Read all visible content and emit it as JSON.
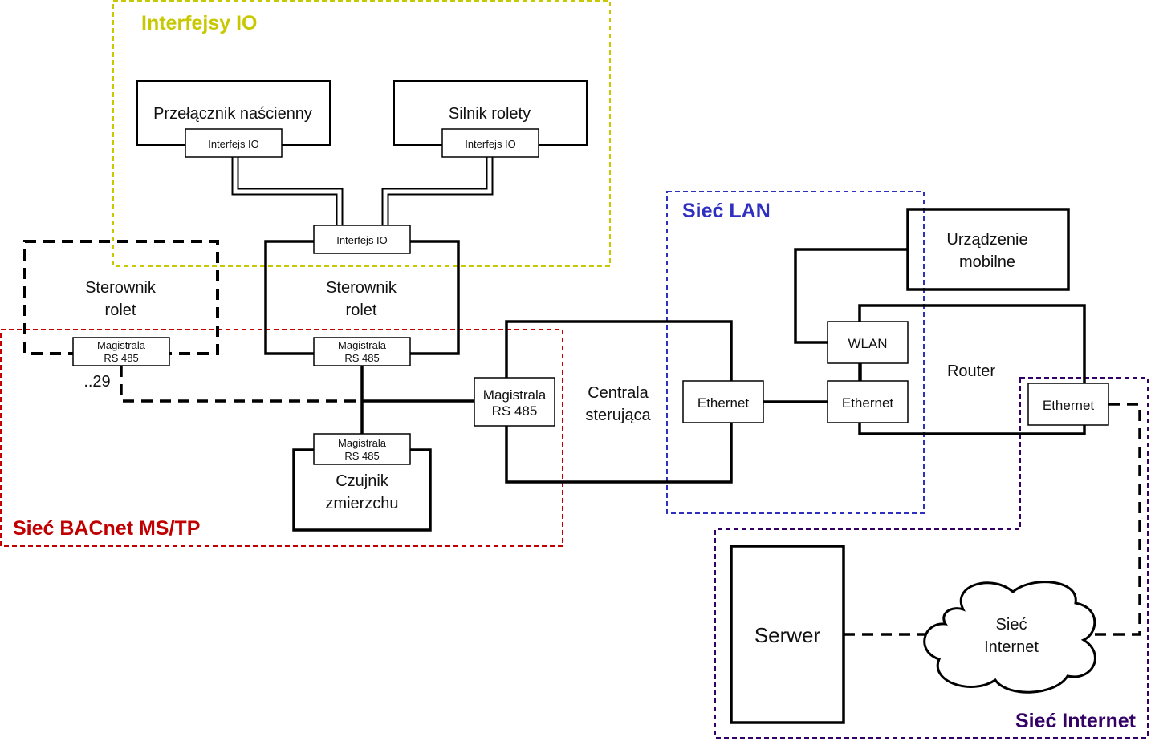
{
  "regions": {
    "io": {
      "label": "Interfejsy IO",
      "color": "#c8c800"
    },
    "bacnet": {
      "label": "Sieć BACnet MS/TP",
      "color": "#c00000"
    },
    "lan": {
      "label": "Sieć LAN",
      "color": "#3030c0"
    },
    "internet": {
      "label": "Sieć Internet",
      "color": "#330066"
    }
  },
  "nodes": {
    "switch": {
      "label": "Przełącznik naścienny",
      "port": "Interfejs IO"
    },
    "motor": {
      "label": "Silnik rolety",
      "port": "Interfejs IO"
    },
    "controller": {
      "line1": "Sterownik",
      "line2": "rolet",
      "port_top": "Interfejs IO",
      "port_bottom_1": "Magistrala",
      "port_bottom_2": "RS 485"
    },
    "controller_more": {
      "line1": "Sterownik",
      "line2": "rolet",
      "port_1": "Magistrala",
      "port_2": "RS 485",
      "count": "..29"
    },
    "sensor": {
      "line1": "Czujnik",
      "line2": "zmierzchu",
      "port_1": "Magistrala",
      "port_2": "RS 485"
    },
    "central": {
      "line1": "Centrala",
      "line2": "sterująca",
      "port_rs_1": "Magistrala",
      "port_rs_2": "RS 485",
      "port_eth": "Ethernet"
    },
    "router": {
      "label": "Router",
      "wlan": "WLAN",
      "eth_lan": "Ethernet",
      "eth_wan": "Ethernet"
    },
    "mobile": {
      "line1": "Urządzenie",
      "line2": "mobilne"
    },
    "server": {
      "label": "Serwer"
    },
    "internet": {
      "line1": "Sieć",
      "line2": "Internet"
    }
  }
}
